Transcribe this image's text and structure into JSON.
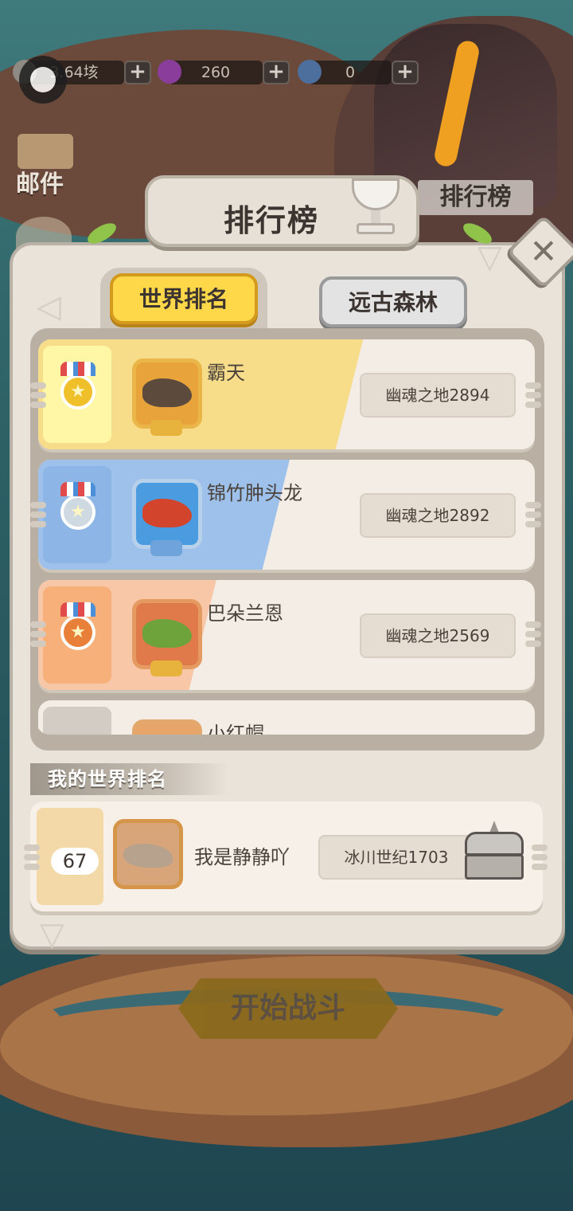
{
  "hud": {
    "gold_value": "3.64垓",
    "gem_value": "260",
    "shell_value": "0",
    "plus_label": "+"
  },
  "side_menu": {
    "mail_label": "邮件",
    "rank_label": "排行榜"
  },
  "panel": {
    "title": "排行榜",
    "close_label": "✕",
    "tabs": [
      {
        "label": "世界排名",
        "active": true
      },
      {
        "label": "远古森林",
        "active": false
      }
    ]
  },
  "ranking_list": [
    {
      "rank_medal": "gold",
      "name": "霸天",
      "server": "幽魂之地2894",
      "band_color": "#f7dd8a",
      "cell_color": "#fff7a6"
    },
    {
      "rank_medal": "silver",
      "name": "锦竹肿头龙",
      "server": "幽魂之地2892",
      "band_color": "#9dc1ea",
      "cell_color": "#8db6e6"
    },
    {
      "rank_medal": "bronze",
      "name": "巴朵兰恩",
      "server": "幽魂之地2569",
      "band_color": "#f8c7a8",
      "cell_color": "#f7b07a"
    },
    {
      "rank_medal": "",
      "name": "小红帽",
      "server": "",
      "band_color": "#f4ede6",
      "cell_color": "#d3ccc4"
    }
  ],
  "my_rank": {
    "section_label": "我的世界排名",
    "rank": "67",
    "name": "我是静静吖",
    "server": "冰川世纪1703"
  },
  "start_button": {
    "label": "开始战斗"
  },
  "colors": {
    "accent_yellow": "#ffd84a",
    "panel_bg": "#e9e3da"
  }
}
